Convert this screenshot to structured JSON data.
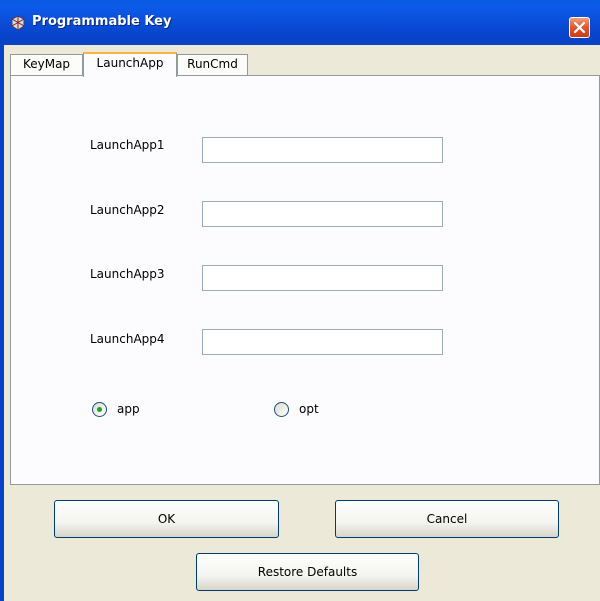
{
  "window": {
    "title": "Programmable Key"
  },
  "tabs": [
    {
      "label": "KeyMap",
      "active": false
    },
    {
      "label": "LaunchApp",
      "active": true
    },
    {
      "label": "RunCmd",
      "active": false
    }
  ],
  "fields": [
    {
      "label": "LaunchApp1",
      "value": ""
    },
    {
      "label": "LaunchApp2",
      "value": ""
    },
    {
      "label": "LaunchApp3",
      "value": ""
    },
    {
      "label": "LaunchApp4",
      "value": ""
    }
  ],
  "radios": [
    {
      "label": "app",
      "checked": true
    },
    {
      "label": "opt",
      "checked": false
    }
  ],
  "buttons": {
    "ok": "OK",
    "cancel": "Cancel",
    "restore": "Restore Defaults"
  },
  "colors": {
    "titlebar": "#0a4dd8",
    "close": "#e45a30",
    "active_tab_accent": "#f7b346",
    "radio_dot": "#21a121"
  }
}
